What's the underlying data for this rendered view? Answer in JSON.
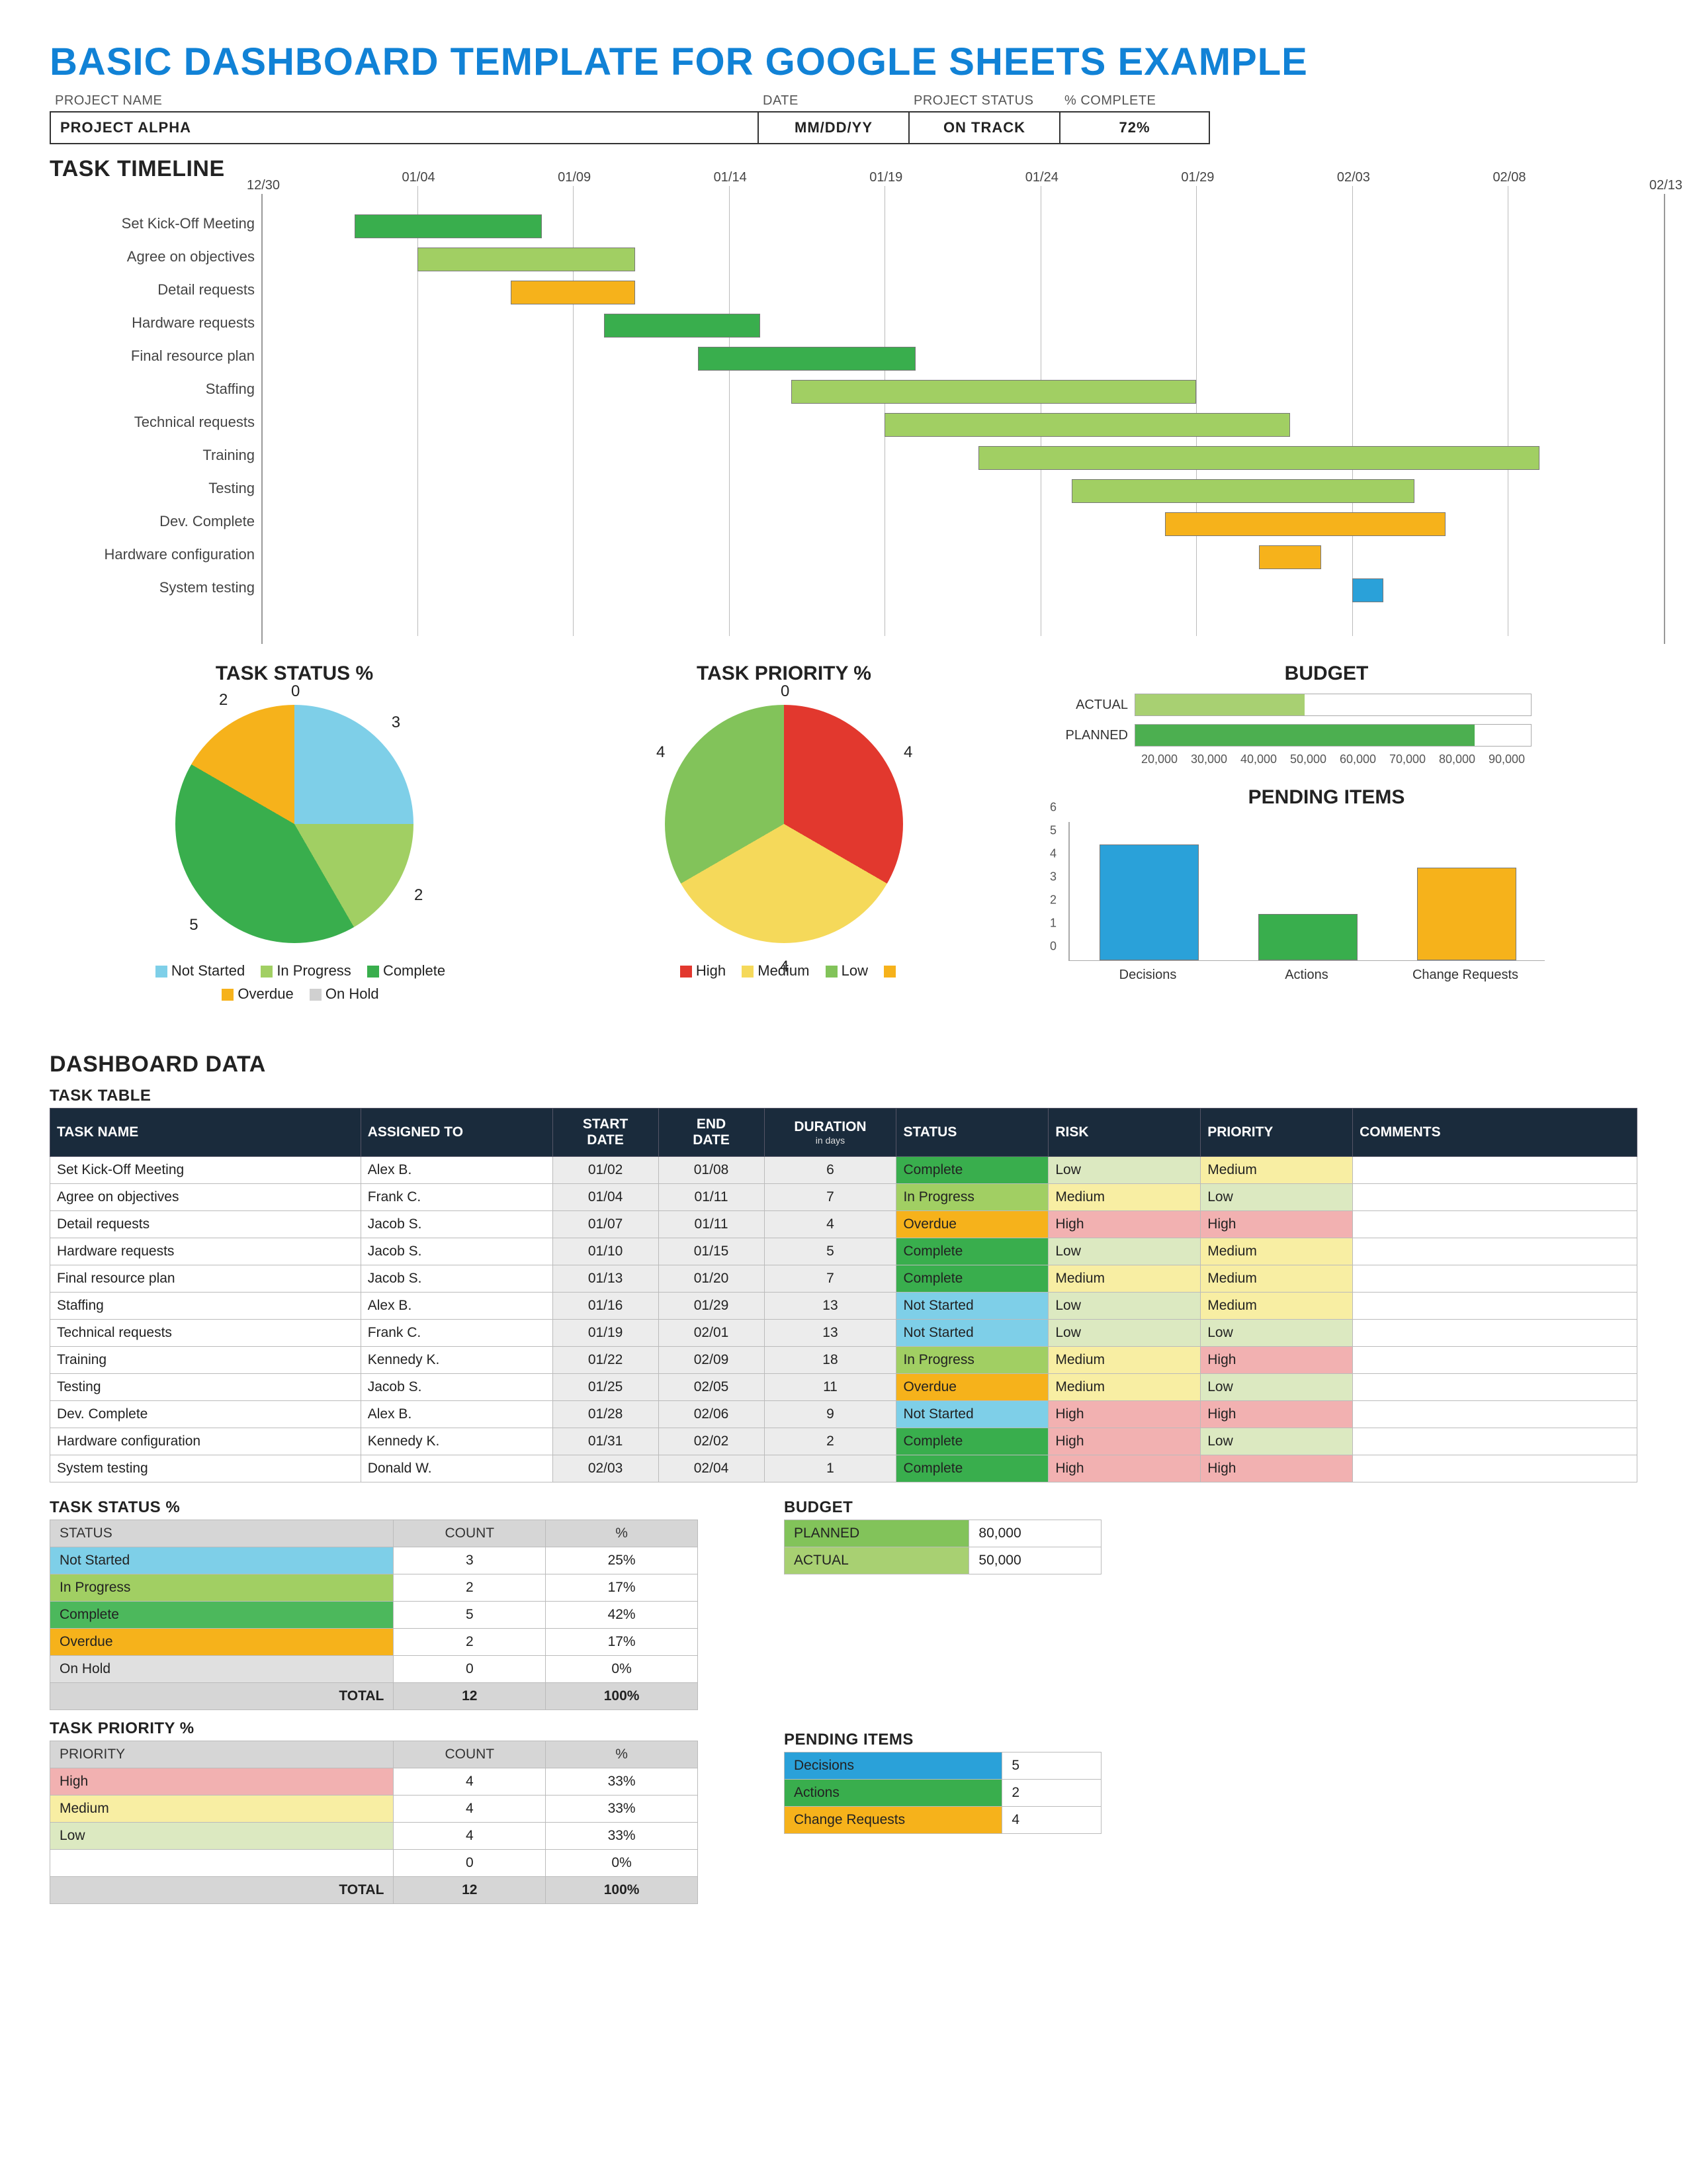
{
  "title": "BASIC DASHBOARD TEMPLATE FOR GOOGLE SHEETS EXAMPLE",
  "header_labels": {
    "project_name": "PROJECT NAME",
    "date": "DATE",
    "status": "PROJECT STATUS",
    "complete": "% COMPLETE"
  },
  "header_values": {
    "project_name": "PROJECT ALPHA",
    "date": "MM/DD/YY",
    "status": "ON TRACK",
    "complete": "72%"
  },
  "section_timeline": "TASK TIMELINE",
  "section_status": "TASK STATUS %",
  "section_priority": "TASK PRIORITY %",
  "section_budget": "BUDGET",
  "section_pending": "PENDING ITEMS",
  "section_dashdata": "DASHBOARD DATA",
  "sub_tasktable": "TASK TABLE",
  "sub_status": "TASK STATUS %",
  "sub_priority": "TASK PRIORITY %",
  "sub_budget": "BUDGET",
  "sub_pending": "PENDING ITEMS",
  "gantt": {
    "ticks": [
      "12/30",
      "01/04",
      "01/09",
      "01/14",
      "01/19",
      "01/24",
      "01/29",
      "02/03",
      "02/08",
      "02/13"
    ],
    "start": "2012-12-30",
    "end": "2013-02-13",
    "rows": [
      {
        "label": "Set Kick-Off Meeting",
        "start": "01/02",
        "end": "01/08",
        "color": "#39ae4d"
      },
      {
        "label": "Agree on objectives",
        "start": "01/04",
        "end": "01/11",
        "color": "#a1cf63"
      },
      {
        "label": "Detail requests",
        "start": "01/07",
        "end": "01/11",
        "color": "#f6b21b"
      },
      {
        "label": "Hardware requests",
        "start": "01/10",
        "end": "01/15",
        "color": "#39ae4d"
      },
      {
        "label": "Final resource plan",
        "start": "01/13",
        "end": "01/20",
        "color": "#39ae4d"
      },
      {
        "label": "Staffing",
        "start": "01/16",
        "end": "01/29",
        "color": "#a1cf63"
      },
      {
        "label": "Technical requests",
        "start": "01/19",
        "end": "02/01",
        "color": "#a1cf63"
      },
      {
        "label": "Training",
        "start": "01/22",
        "end": "02/09",
        "color": "#a1cf63"
      },
      {
        "label": "Testing",
        "start": "01/25",
        "end": "02/05",
        "color": "#a1cf63"
      },
      {
        "label": "Dev. Complete",
        "start": "01/28",
        "end": "02/06",
        "color": "#f6b21b"
      },
      {
        "label": "Hardware configuration",
        "start": "01/31",
        "end": "02/02",
        "color": "#f6b21b"
      },
      {
        "label": "System testing",
        "start": "02/03",
        "end": "02/04",
        "color": "#2aa1d9"
      }
    ]
  },
  "chart_data": [
    {
      "id": "task_status_pie",
      "type": "pie",
      "title": "TASK STATUS %",
      "slices": [
        {
          "name": "Not Started",
          "value": 3,
          "color": "#7ecfe8"
        },
        {
          "name": "In Progress",
          "value": 2,
          "color": "#a1cf63"
        },
        {
          "name": "Complete",
          "value": 5,
          "color": "#39ae4d"
        },
        {
          "name": "Overdue",
          "value": 2,
          "color": "#f6b21b"
        },
        {
          "name": "On Hold",
          "value": 0,
          "color": "#d0d0d0"
        }
      ],
      "total": 12,
      "labels_cw_from_top": [
        "0",
        "3",
        "2",
        "5",
        "2"
      ]
    },
    {
      "id": "task_priority_pie",
      "type": "pie",
      "title": "TASK PRIORITY %",
      "slices": [
        {
          "name": "High",
          "value": 4,
          "color": "#e2382e"
        },
        {
          "name": "Medium",
          "value": 4,
          "color": "#f5d95a"
        },
        {
          "name": "Low",
          "value": 4,
          "color": "#82c35a"
        },
        {
          "name": "",
          "value": 0,
          "color": "#f6b21b"
        }
      ],
      "total": 12,
      "labels_cw_from_top": [
        "0",
        "4",
        "4",
        "4"
      ]
    },
    {
      "id": "budget_bar",
      "type": "bar",
      "orientation": "horizontal",
      "title": "BUDGET",
      "categories": [
        "ACTUAL",
        "PLANNED"
      ],
      "values": [
        50000,
        80000
      ],
      "colors": [
        "#a8d072",
        "#4caf50"
      ],
      "xlim": [
        20000,
        90000
      ],
      "xticks": [
        20000,
        30000,
        40000,
        50000,
        60000,
        70000,
        80000,
        90000
      ],
      "xticklabels": [
        "20,000",
        "30,000",
        "40,000",
        "50,000",
        "60,000",
        "70,000",
        "80,000",
        "90,000"
      ]
    },
    {
      "id": "pending_bar",
      "type": "bar",
      "orientation": "vertical",
      "title": "PENDING ITEMS",
      "categories": [
        "Decisions",
        "Actions",
        "Change Requests"
      ],
      "values": [
        5,
        2,
        4
      ],
      "colors": [
        "#2aa1d9",
        "#39ae4d",
        "#f6b21b"
      ],
      "ylim": [
        0,
        6
      ],
      "yticks": [
        0,
        1,
        2,
        3,
        4,
        5,
        6
      ]
    }
  ],
  "legend_status": [
    "Not Started",
    "In Progress",
    "Complete",
    "Overdue",
    "On Hold"
  ],
  "legend_priority": [
    "High",
    "Medium",
    "Low",
    ""
  ],
  "task_table": {
    "headers": {
      "name": "TASK NAME",
      "assigned": "ASSIGNED TO",
      "start": "START DATE",
      "end": "END DATE",
      "duration": "DURATION",
      "duration_sub": "in days",
      "status": "STATUS",
      "risk": "RISK",
      "priority": "PRIORITY",
      "comments": "COMMENTS"
    },
    "rows": [
      {
        "name": "Set Kick-Off Meeting",
        "assigned": "Alex B.",
        "start": "01/02",
        "end": "01/08",
        "duration": "6",
        "status": "Complete",
        "risk": "Low",
        "priority": "Medium"
      },
      {
        "name": "Agree on objectives",
        "assigned": "Frank C.",
        "start": "01/04",
        "end": "01/11",
        "duration": "7",
        "status": "In Progress",
        "risk": "Medium",
        "priority": "Low"
      },
      {
        "name": "Detail requests",
        "assigned": "Jacob S.",
        "start": "01/07",
        "end": "01/11",
        "duration": "4",
        "status": "Overdue",
        "risk": "High",
        "priority": "High"
      },
      {
        "name": "Hardware requests",
        "assigned": "Jacob S.",
        "start": "01/10",
        "end": "01/15",
        "duration": "5",
        "status": "Complete",
        "risk": "Low",
        "priority": "Medium"
      },
      {
        "name": "Final resource plan",
        "assigned": "Jacob S.",
        "start": "01/13",
        "end": "01/20",
        "duration": "7",
        "status": "Complete",
        "risk": "Medium",
        "priority": "Medium"
      },
      {
        "name": "Staffing",
        "assigned": "Alex B.",
        "start": "01/16",
        "end": "01/29",
        "duration": "13",
        "status": "Not Started",
        "risk": "Low",
        "priority": "Medium"
      },
      {
        "name": "Technical requests",
        "assigned": "Frank C.",
        "start": "01/19",
        "end": "02/01",
        "duration": "13",
        "status": "Not Started",
        "risk": "Low",
        "priority": "Low"
      },
      {
        "name": "Training",
        "assigned": "Kennedy K.",
        "start": "01/22",
        "end": "02/09",
        "duration": "18",
        "status": "In Progress",
        "risk": "Medium",
        "priority": "High"
      },
      {
        "name": "Testing",
        "assigned": "Jacob S.",
        "start": "01/25",
        "end": "02/05",
        "duration": "11",
        "status": "Overdue",
        "risk": "Medium",
        "priority": "Low"
      },
      {
        "name": "Dev. Complete",
        "assigned": "Alex B.",
        "start": "01/28",
        "end": "02/06",
        "duration": "9",
        "status": "Not Started",
        "risk": "High",
        "priority": "High"
      },
      {
        "name": "Hardware configuration",
        "assigned": "Kennedy K.",
        "start": "01/31",
        "end": "02/02",
        "duration": "2",
        "status": "Complete",
        "risk": "High",
        "priority": "Low"
      },
      {
        "name": "System testing",
        "assigned": "Donald W.",
        "start": "02/03",
        "end": "02/04",
        "duration": "1",
        "status": "Complete",
        "risk": "High",
        "priority": "High"
      }
    ]
  },
  "status_table": {
    "headers": {
      "status": "STATUS",
      "count": "COUNT",
      "pct": "%"
    },
    "rows": [
      {
        "status": "Not Started",
        "count": 3,
        "pct": "25%",
        "cls": "bg-notstarted"
      },
      {
        "status": "In Progress",
        "count": 2,
        "pct": "17%",
        "cls": "bg-inprogress"
      },
      {
        "status": "Complete",
        "count": 5,
        "pct": "42%",
        "cls": "bg-complete2"
      },
      {
        "status": "Overdue",
        "count": 2,
        "pct": "17%",
        "cls": "bg-overdue"
      },
      {
        "status": "On Hold",
        "count": 0,
        "pct": "0%",
        "cls": "bg-onhold"
      }
    ],
    "total_label": "TOTAL",
    "total_count": 12,
    "total_pct": "100%"
  },
  "priority_table": {
    "headers": {
      "priority": "PRIORITY",
      "count": "COUNT",
      "pct": "%"
    },
    "rows": [
      {
        "priority": "High",
        "count": 4,
        "pct": "33%",
        "cls": "bg-high"
      },
      {
        "priority": "Medium",
        "count": 4,
        "pct": "33%",
        "cls": "bg-medium"
      },
      {
        "priority": "Low",
        "count": 4,
        "pct": "33%",
        "cls": "bg-low"
      },
      {
        "priority": "",
        "count": 0,
        "pct": "0%",
        "cls": ""
      }
    ],
    "total_label": "TOTAL",
    "total_count": 12,
    "total_pct": "100%"
  },
  "budget_table": {
    "rows": [
      {
        "label": "PLANNED",
        "value": "80,000",
        "cls": "bg-planned"
      },
      {
        "label": "ACTUAL",
        "value": "50,000",
        "cls": "bg-actual"
      }
    ]
  },
  "pending_table": {
    "rows": [
      {
        "label": "Decisions",
        "value": 5,
        "cls": "bg-decisions"
      },
      {
        "label": "Actions",
        "value": 2,
        "cls": "bg-actions"
      },
      {
        "label": "Change Requests",
        "value": 4,
        "cls": "bg-changereq"
      }
    ]
  }
}
